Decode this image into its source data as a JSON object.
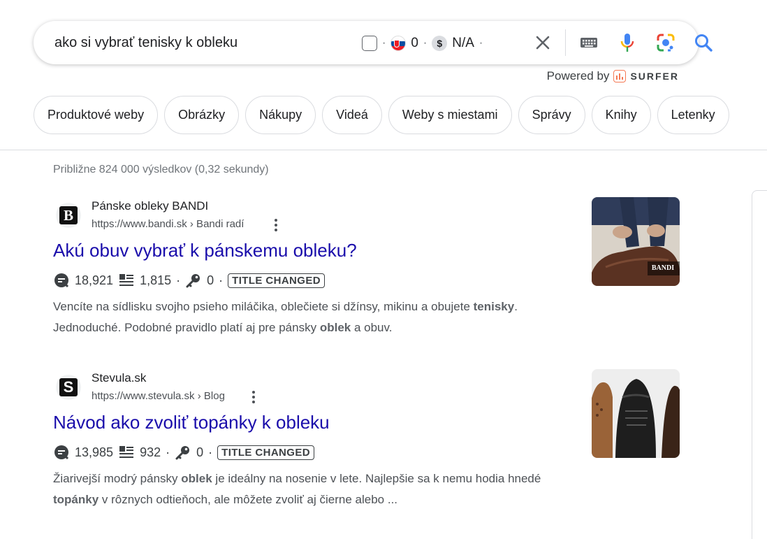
{
  "search": {
    "query": "ako si vybrať tenisky k obleku",
    "surfer_count": "0",
    "surfer_value": "N/A",
    "powered_by": "Powered by",
    "surfer_brand": "SURFER"
  },
  "chips": [
    "Produktové weby",
    "Obrázky",
    "Nákupy",
    "Videá",
    "Weby s miestami",
    "Správy",
    "Knihy",
    "Letenky"
  ],
  "stats_text": "Približne 824 000 výsledkov (0,32 sekundy)",
  "results": [
    {
      "favicon_letter": "B",
      "site_name": "Pánske obleky BANDI",
      "url": "https://www.bandi.sk › Bandi radí",
      "title": "Akú obuv vybrať k pánskemu obleku?",
      "metric_traffic": "18,921",
      "metric_words": "1,815",
      "metric_keywords": "0",
      "badge": "TITLE CHANGED",
      "snippet_parts": [
        "Vencíte na sídlisku svojho psieho miláčika, oblečiete si džínsy, mikinu a obujete ",
        "tenisky",
        ". Jednoduché. Podobné pravidlo platí aj pre pánsky ",
        "oblek",
        " a obuv."
      ],
      "thumb_label": "BANDI"
    },
    {
      "favicon_letter": "S",
      "site_name": "Stevula.sk",
      "url": "https://www.stevula.sk › Blog",
      "title": "Návod ako zvoliť topánky k obleku",
      "metric_traffic": "13,985",
      "metric_words": "932",
      "metric_keywords": "0",
      "badge": "TITLE CHANGED",
      "snippet_parts": [
        "Žiarivejší modrý pánsky ",
        "oblek",
        " je ideálny na nosenie v lete. Najlepšie sa k nemu hodia ",
        "hnedé ",
        "topánky",
        " v rôznych odtieňoch, ale môžete zvoliť aj čierne alebo ..."
      ]
    }
  ]
}
